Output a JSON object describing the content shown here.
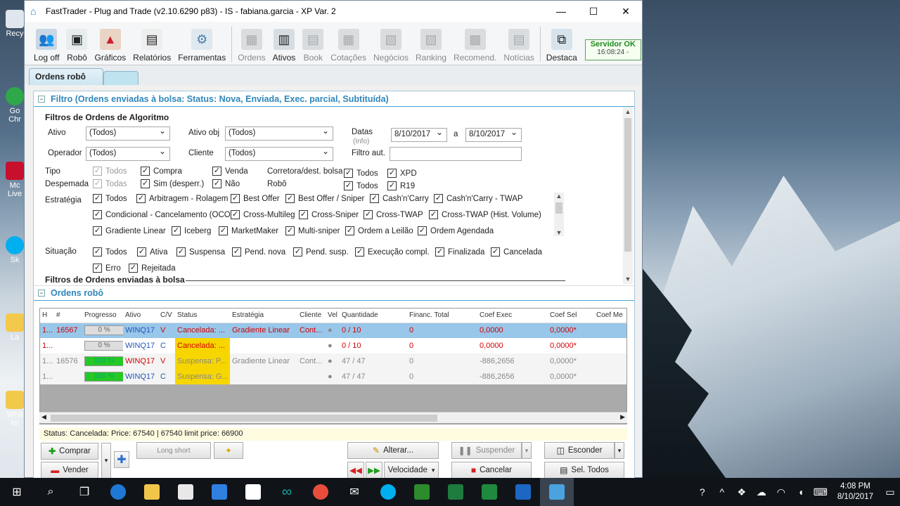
{
  "window": {
    "title": "FastTrader - Plug and Trade (v2.10.6290 p83) - IS - fabiana.garcia - XP Var. 2",
    "minimize": "—",
    "maximize": "☐",
    "close": "✕"
  },
  "toolbar": {
    "logoff": "Log off",
    "robo": "Robô",
    "graficos": "Gráficos",
    "relatorios": "Relatórios",
    "ferramentas": "Ferramentas",
    "ordens": "Ordens",
    "ativos": "Ativos",
    "book": "Book",
    "cotacoes": "Cotações",
    "negocios": "Negócios",
    "ranking": "Ranking",
    "recomend": "Recomend.",
    "noticias": "Notícias",
    "destaca": "Destaca"
  },
  "server": {
    "status": "Servidor OK",
    "time": "16:08:24 -"
  },
  "tab": {
    "active": "Ordens robô"
  },
  "filter_section": {
    "title": "Filtro (Ordens enviadas à bolsa: Status: Nova, Enviada, Exec. parcial, Subtituída)",
    "algo_heading": "Filtros de Ordens de Algoritmo",
    "ativo_label": "Ativo",
    "ativo_value": "(Todos)",
    "ativo_obj_label": "Ativo obj",
    "ativo_obj_value": "(Todos)",
    "datas_label": "Datas",
    "info_label": "(Info)",
    "date_from": "8/10/2017",
    "date_sep": "a",
    "date_to": "8/10/2017",
    "operador_label": "Operador",
    "operador_value": "(Todos)",
    "cliente_label": "Cliente",
    "cliente_value": "(Todos)",
    "filtro_aut_label": "Filtro aut.",
    "tipo_label": "Tipo",
    "despemada_label": "Despemada",
    "tipo_todos": "Todos",
    "tipo_compra": "Compra",
    "tipo_venda": "Venda",
    "desp_todas": "Todas",
    "desp_sim": "Sim (desperr.)",
    "desp_nao": "Não",
    "corretora_label": "Corretora/dest. bolsa",
    "robo_label": "Robô",
    "corr_todos": "Todos",
    "corr_xpd": "XPD",
    "robo_todos": "Todos",
    "robo_r19": "R19",
    "estrategia_label": "Estratégia",
    "estrategias": [
      "Todos",
      "Arbitragem - Rolagem",
      "Best Offer",
      "Best Offer / Sniper",
      "Cash'n'Carry",
      "Cash'n'Carry - TWAP",
      "Condicional - Cancelamento (OCO)",
      "Cross-Multileg",
      "Cross-Sniper",
      "Cross-TWAP",
      "Cross-TWAP (Hist. Volume)",
      "Gradiente Linear",
      "Iceberg",
      "MarketMaker",
      "Multi-sniper",
      "Ordem a Leilão",
      "Ordem Agendada"
    ],
    "situacao_label": "Situação",
    "situacoes": [
      "Todos",
      "Ativa",
      "Suspensa",
      "Pend. nova",
      "Pend. susp.",
      "Execução compl.",
      "Finalizada",
      "Cancelada",
      "Erro",
      "Rejeitada"
    ],
    "bolsa_heading": "Filtros de Ordens enviadas à bolsa"
  },
  "orders_section": {
    "title": "Ordens robô"
  },
  "table": {
    "headers": [
      "H",
      "#",
      "Progresso",
      "Ativo",
      "C/V",
      "Status",
      "Estratégia",
      "Cliente",
      "Vel",
      "Quantidade",
      "Financ. Total",
      "Coef Exec",
      "Coef Sel",
      "Coef Me"
    ],
    "rows": [
      {
        "h": "1...",
        "num": "16567",
        "prog": "0 %",
        "ativo": "WINQ17",
        "cv": "V",
        "status": "Cancelada: ...",
        "estrategia": "Gradiente Linear",
        "cliente": "Cont...",
        "vel": "●",
        "qtd": "0 / 10",
        "fin": "0",
        "coef_exec": "0,0000",
        "coef_sel": "0,0000*"
      },
      {
        "h": "1...",
        "num": "",
        "prog": "0 %",
        "ativo": "WINQ17",
        "cv": "C",
        "status": "Cancelada: ...",
        "estrategia": "",
        "cliente": "",
        "vel": "●",
        "qtd": "0 / 10",
        "fin": "0",
        "coef_exec": "0,0000",
        "coef_sel": "0,0000*"
      },
      {
        "h": "1...",
        "num": "16576",
        "prog": "100 %",
        "ativo": "WINQ17",
        "cv": "V",
        "status": "Suspensa: P...",
        "estrategia": "Gradiente Linear",
        "cliente": "Cont...",
        "vel": "●",
        "qtd": "47 / 47",
        "fin": "0",
        "coef_exec": "-886,2656",
        "coef_sel": "0,0000*"
      },
      {
        "h": "1...",
        "num": "",
        "prog": "100 %",
        "ativo": "WINQ17",
        "cv": "C",
        "status": "Suspensa: G...",
        "estrategia": "",
        "cliente": "",
        "vel": "●",
        "qtd": "47 / 47",
        "fin": "0",
        "coef_exec": "-886,2656",
        "coef_sel": "0,0000*"
      }
    ]
  },
  "status_text": "Status: Cancelada: Price: 67540 | 67540 limit price: 66900",
  "buttons": {
    "comprar": "Comprar",
    "vender": "Vender",
    "long_short": "Long short",
    "alterar": "Alterar...",
    "suspender": "Suspender",
    "esconder": "Esconder",
    "velocidade": "Velocidade",
    "cancelar": "Cancelar",
    "sel_todos": "Sel. Todos"
  },
  "taskbar": {
    "time": "4:08 PM",
    "date": "8/10/2017"
  },
  "desktop_icons": [
    "Recy",
    "Go Chr",
    "Mc Live",
    "Sk",
    "La",
    "Wha Im"
  ]
}
